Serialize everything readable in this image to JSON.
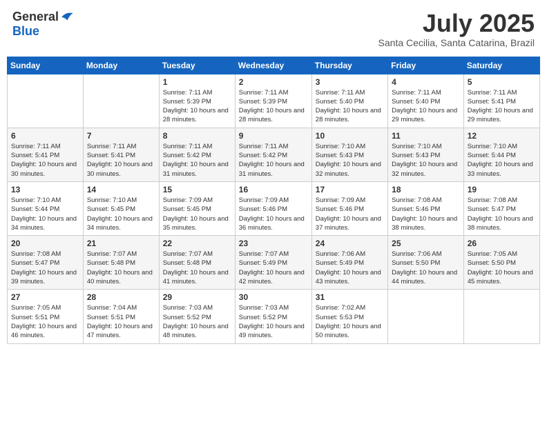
{
  "header": {
    "logo_general": "General",
    "logo_blue": "Blue",
    "month_title": "July 2025",
    "subtitle": "Santa Cecilia, Santa Catarina, Brazil"
  },
  "weekdays": [
    "Sunday",
    "Monday",
    "Tuesday",
    "Wednesday",
    "Thursday",
    "Friday",
    "Saturday"
  ],
  "weeks": [
    [
      {
        "day": "",
        "info": ""
      },
      {
        "day": "",
        "info": ""
      },
      {
        "day": "1",
        "info": "Sunrise: 7:11 AM\nSunset: 5:39 PM\nDaylight: 10 hours and 28 minutes."
      },
      {
        "day": "2",
        "info": "Sunrise: 7:11 AM\nSunset: 5:39 PM\nDaylight: 10 hours and 28 minutes."
      },
      {
        "day": "3",
        "info": "Sunrise: 7:11 AM\nSunset: 5:40 PM\nDaylight: 10 hours and 28 minutes."
      },
      {
        "day": "4",
        "info": "Sunrise: 7:11 AM\nSunset: 5:40 PM\nDaylight: 10 hours and 29 minutes."
      },
      {
        "day": "5",
        "info": "Sunrise: 7:11 AM\nSunset: 5:41 PM\nDaylight: 10 hours and 29 minutes."
      }
    ],
    [
      {
        "day": "6",
        "info": "Sunrise: 7:11 AM\nSunset: 5:41 PM\nDaylight: 10 hours and 30 minutes."
      },
      {
        "day": "7",
        "info": "Sunrise: 7:11 AM\nSunset: 5:41 PM\nDaylight: 10 hours and 30 minutes."
      },
      {
        "day": "8",
        "info": "Sunrise: 7:11 AM\nSunset: 5:42 PM\nDaylight: 10 hours and 31 minutes."
      },
      {
        "day": "9",
        "info": "Sunrise: 7:11 AM\nSunset: 5:42 PM\nDaylight: 10 hours and 31 minutes."
      },
      {
        "day": "10",
        "info": "Sunrise: 7:10 AM\nSunset: 5:43 PM\nDaylight: 10 hours and 32 minutes."
      },
      {
        "day": "11",
        "info": "Sunrise: 7:10 AM\nSunset: 5:43 PM\nDaylight: 10 hours and 32 minutes."
      },
      {
        "day": "12",
        "info": "Sunrise: 7:10 AM\nSunset: 5:44 PM\nDaylight: 10 hours and 33 minutes."
      }
    ],
    [
      {
        "day": "13",
        "info": "Sunrise: 7:10 AM\nSunset: 5:44 PM\nDaylight: 10 hours and 34 minutes."
      },
      {
        "day": "14",
        "info": "Sunrise: 7:10 AM\nSunset: 5:45 PM\nDaylight: 10 hours and 34 minutes."
      },
      {
        "day": "15",
        "info": "Sunrise: 7:09 AM\nSunset: 5:45 PM\nDaylight: 10 hours and 35 minutes."
      },
      {
        "day": "16",
        "info": "Sunrise: 7:09 AM\nSunset: 5:46 PM\nDaylight: 10 hours and 36 minutes."
      },
      {
        "day": "17",
        "info": "Sunrise: 7:09 AM\nSunset: 5:46 PM\nDaylight: 10 hours and 37 minutes."
      },
      {
        "day": "18",
        "info": "Sunrise: 7:08 AM\nSunset: 5:46 PM\nDaylight: 10 hours and 38 minutes."
      },
      {
        "day": "19",
        "info": "Sunrise: 7:08 AM\nSunset: 5:47 PM\nDaylight: 10 hours and 38 minutes."
      }
    ],
    [
      {
        "day": "20",
        "info": "Sunrise: 7:08 AM\nSunset: 5:47 PM\nDaylight: 10 hours and 39 minutes."
      },
      {
        "day": "21",
        "info": "Sunrise: 7:07 AM\nSunset: 5:48 PM\nDaylight: 10 hours and 40 minutes."
      },
      {
        "day": "22",
        "info": "Sunrise: 7:07 AM\nSunset: 5:48 PM\nDaylight: 10 hours and 41 minutes."
      },
      {
        "day": "23",
        "info": "Sunrise: 7:07 AM\nSunset: 5:49 PM\nDaylight: 10 hours and 42 minutes."
      },
      {
        "day": "24",
        "info": "Sunrise: 7:06 AM\nSunset: 5:49 PM\nDaylight: 10 hours and 43 minutes."
      },
      {
        "day": "25",
        "info": "Sunrise: 7:06 AM\nSunset: 5:50 PM\nDaylight: 10 hours and 44 minutes."
      },
      {
        "day": "26",
        "info": "Sunrise: 7:05 AM\nSunset: 5:50 PM\nDaylight: 10 hours and 45 minutes."
      }
    ],
    [
      {
        "day": "27",
        "info": "Sunrise: 7:05 AM\nSunset: 5:51 PM\nDaylight: 10 hours and 46 minutes."
      },
      {
        "day": "28",
        "info": "Sunrise: 7:04 AM\nSunset: 5:51 PM\nDaylight: 10 hours and 47 minutes."
      },
      {
        "day": "29",
        "info": "Sunrise: 7:03 AM\nSunset: 5:52 PM\nDaylight: 10 hours and 48 minutes."
      },
      {
        "day": "30",
        "info": "Sunrise: 7:03 AM\nSunset: 5:52 PM\nDaylight: 10 hours and 49 minutes."
      },
      {
        "day": "31",
        "info": "Sunrise: 7:02 AM\nSunset: 5:53 PM\nDaylight: 10 hours and 50 minutes."
      },
      {
        "day": "",
        "info": ""
      },
      {
        "day": "",
        "info": ""
      }
    ]
  ]
}
